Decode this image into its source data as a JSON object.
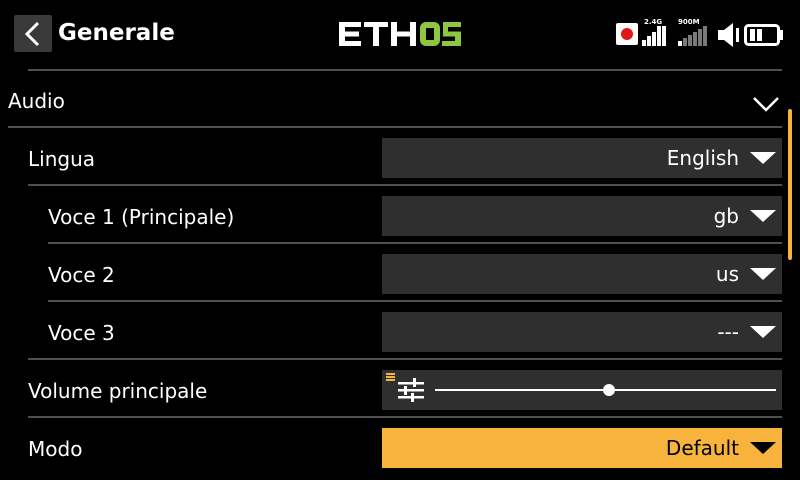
{
  "header": {
    "back_icon": "chevron-left-icon",
    "title": "Generale",
    "logo_text": "ETHOS",
    "status": {
      "band_1_label": "2.4G",
      "band_2_label": "900M"
    }
  },
  "section": {
    "title": "Audio",
    "icon": "chevron-down-icon"
  },
  "rows": {
    "language": {
      "label": "Lingua",
      "value": "English"
    },
    "voice1": {
      "label": "Voce 1 (Principale)",
      "value": "gb"
    },
    "voice2": {
      "label": "Voce 2",
      "value": "us"
    },
    "voice3": {
      "label": "Voce 3",
      "value": "---"
    },
    "volume": {
      "label": "Volume principale",
      "level": 0.51
    },
    "mode": {
      "label": "Modo",
      "value": "Default"
    }
  },
  "colors": {
    "accent": "#f7b33b",
    "logo_accent": "#8dc63f",
    "field_bg": "#2f2f2f",
    "separator": "#505050"
  }
}
